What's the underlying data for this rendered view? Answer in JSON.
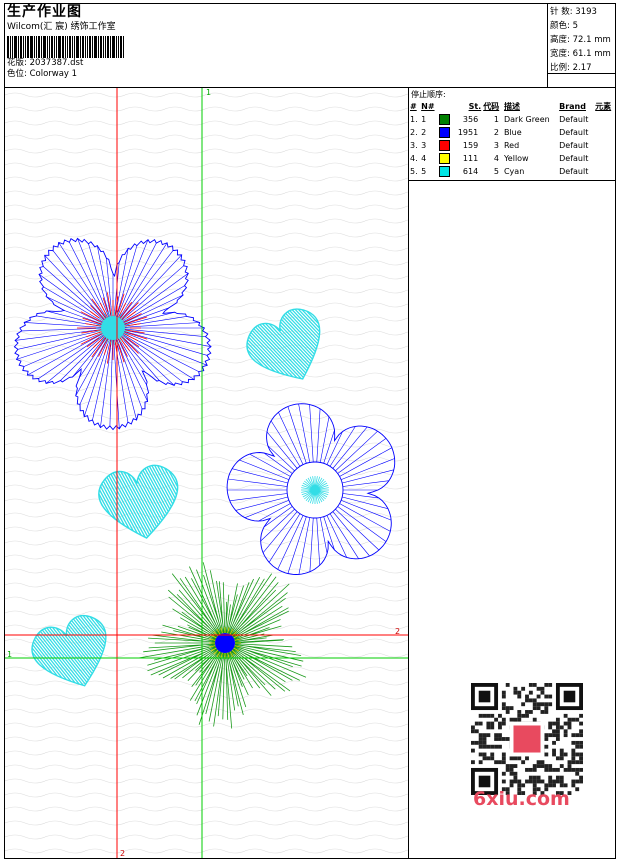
{
  "header": {
    "title": "生产作业图",
    "subtitle": "Wilcom(汇 宸) 绣饰工作室",
    "design_label": "花版:",
    "design_file": "2037387.dst",
    "colorway_label": "色位:",
    "colorway": "Colorway 1"
  },
  "stats": {
    "stitches_label": "针 数:",
    "stitches": "3193",
    "colors_label": "颜色:",
    "colors": "5",
    "height_label": "高度:",
    "height": "72.1 mm",
    "width_label": "宽度:",
    "width": "61.1 mm",
    "ratio_label": "比例:",
    "ratio": "2.17"
  },
  "stop_sequence": {
    "title": "停止顺序:",
    "columns": [
      "#",
      "N#",
      "St.",
      "代码",
      "描述",
      "Brand",
      "元素"
    ],
    "rows": [
      {
        "idx": "1.",
        "n": "1",
        "color": "#008000",
        "st": "356",
        "code": "1",
        "desc": "Dark Green",
        "brand": "Default"
      },
      {
        "idx": "2.",
        "n": "2",
        "color": "#0000ff",
        "st": "1951",
        "code": "2",
        "desc": "Blue",
        "brand": "Default"
      },
      {
        "idx": "3.",
        "n": "3",
        "color": "#ff0000",
        "st": "159",
        "code": "3",
        "desc": "Red",
        "brand": "Default"
      },
      {
        "idx": "4.",
        "n": "4",
        "color": "#ffff00",
        "st": "111",
        "code": "4",
        "desc": "Yellow",
        "brand": "Default"
      },
      {
        "idx": "5.",
        "n": "5",
        "color": "#00e5e5",
        "st": "614",
        "code": "5",
        "desc": "Cyan",
        "brand": "Default"
      }
    ]
  },
  "guides": {
    "v1": "1",
    "v2": "2",
    "h1": "1",
    "h2": "2"
  },
  "watermark": "6xiu.com",
  "colors": {
    "blue": "#0000ff",
    "red": "#ff0000",
    "green": "#00c000",
    "cyan": "#33dde6",
    "darkgreen": "#1a9a1a"
  }
}
